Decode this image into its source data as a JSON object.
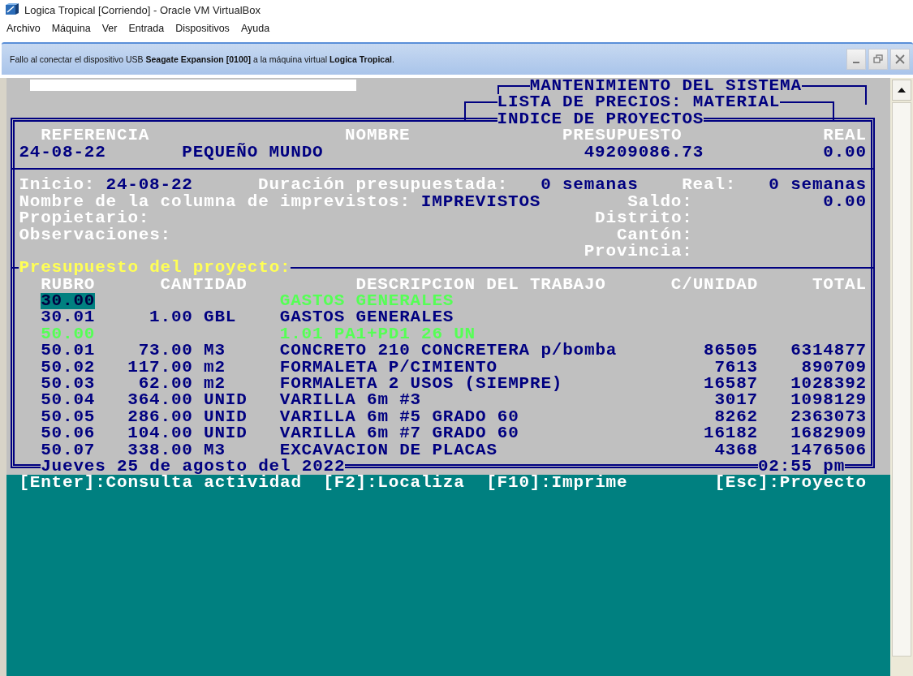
{
  "window": {
    "title": "Logica Tropical [Corriendo] - Oracle VM VirtualBox"
  },
  "menu": [
    "Archivo",
    "Máquina",
    "Ver",
    "Entrada",
    "Dispositivos",
    "Ayuda"
  ],
  "notification": {
    "message": "Fallo al conectar el dispositivo USB **Seagate Expansion [0100]** a la máquina virtual **Logica Tropical**."
  },
  "screen": {
    "titles": [
      "MANTENIMIENTO DEL SISTEMA",
      "LISTA DE PRECIOS: MATERIAL",
      "INDICE DE PROYECTOS"
    ],
    "project": {
      "headers": {
        "reference": "REFERENCIA",
        "name": "NOMBRE",
        "budget": "PRESUPUESTO",
        "actual": "REAL"
      },
      "reference": "24-08-22",
      "name": "PEQUEÑO MUNDO",
      "budget": "49209086.73",
      "actual": "0.00"
    },
    "details": {
      "start_label": "Inicio:",
      "start": "24-08-22",
      "duration_label": "Duración presupuestada:",
      "duration": "0 semanas",
      "real_label": "Real:",
      "real": "0 semanas",
      "contingency_label": "Nombre de la columna de imprevistos:",
      "contingency": "IMPREVISTOS",
      "balance_label": "Saldo:",
      "balance": "0.00",
      "owner_label": "Propietario:",
      "district_label": "Distrito:",
      "notes_label": "Observaciones:",
      "canton_label": "Cantón:",
      "province_label": "Provincia:"
    },
    "budget_title": "Presupuesto del proyecto:",
    "table": {
      "columns": [
        "RUBRO",
        "CANTIDAD",
        "DESCRIPCION DEL TRABAJO",
        "C/UNIDAD",
        "TOTAL"
      ],
      "rows": [
        {
          "kind": "group",
          "selected": true,
          "rubro": "30.00",
          "description": "GASTOS GENERALES"
        },
        {
          "kind": "item",
          "selected": false,
          "rubro": "30.01",
          "quantity": "1.00",
          "unit": "GBL",
          "description": "GASTOS GENERALES"
        },
        {
          "kind": "group",
          "selected": false,
          "rubro": "50.00",
          "description": "1.01 PA1+PD1 26 UN"
        },
        {
          "kind": "item",
          "selected": false,
          "rubro": "50.01",
          "quantity": "73.00",
          "unit": "M3",
          "description": "CONCRETO 210 CONCRETERA p/bomba",
          "unit_cost": "86505",
          "total": "6314877"
        },
        {
          "kind": "item",
          "selected": false,
          "rubro": "50.02",
          "quantity": "117.00",
          "unit": "m2",
          "description": "FORMALETA P/CIMIENTO",
          "unit_cost": "7613",
          "total": "890709"
        },
        {
          "kind": "item",
          "selected": false,
          "rubro": "50.03",
          "quantity": "62.00",
          "unit": "m2",
          "description": "FORMALETA 2 USOS (SIEMPRE)",
          "unit_cost": "16587",
          "total": "1028392"
        },
        {
          "kind": "item",
          "selected": false,
          "rubro": "50.04",
          "quantity": "364.00",
          "unit": "UNID",
          "description": "VARILLA 6m #3",
          "unit_cost": "3017",
          "total": "1098129"
        },
        {
          "kind": "item",
          "selected": false,
          "rubro": "50.05",
          "quantity": "286.00",
          "unit": "UNID",
          "description": "VARILLA 6m #5 GRADO 60",
          "unit_cost": "8262",
          "total": "2363073"
        },
        {
          "kind": "item",
          "selected": false,
          "rubro": "50.06",
          "quantity": "104.00",
          "unit": "UNID",
          "description": "VARILLA 6m #7 GRADO 60",
          "unit_cost": "16182",
          "total": "1682909"
        },
        {
          "kind": "item",
          "selected": false,
          "rubro": "50.07",
          "quantity": "338.00",
          "unit": "M3",
          "description": "EXCAVACION DE PLACAS",
          "unit_cost": "4368",
          "total": "1476506"
        }
      ]
    },
    "date": "Jueves 25 de agosto del 2022",
    "time": "02:55 pm",
    "keys": [
      "[Enter]:Consulta actividad",
      "[F2]:Localiza",
      "[F10]:Imprime",
      "[Esc]:Proyecto"
    ]
  }
}
